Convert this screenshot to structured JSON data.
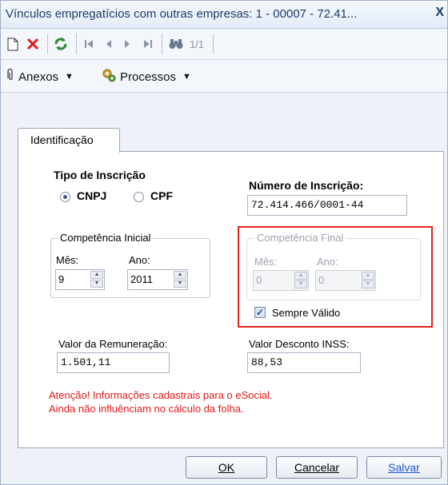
{
  "window": {
    "title": "Vínculos empregatícios com outras empresas: 1 - 00007 - 72.41...",
    "close_label": "X"
  },
  "toolbar": {
    "record_counter": "1/1",
    "icons": [
      "new-document-icon",
      "delete-icon",
      "refresh-icon",
      "first-record-icon",
      "previous-record-icon",
      "next-record-icon",
      "last-record-icon",
      "binoculars-icon"
    ]
  },
  "menus": {
    "anexos_label": "Anexos",
    "processos_label": "Processos"
  },
  "tabs": [
    {
      "label": "Identificação"
    }
  ],
  "form": {
    "tipo_inscricao": {
      "title": "Tipo de Inscrição",
      "cnpj_label": "CNPJ",
      "cpf_label": "CPF",
      "selected": "CNPJ"
    },
    "numero_inscricao": {
      "label": "Número de Inscrição:",
      "value": "72.414.466/0001-44"
    },
    "competencia_inicial": {
      "title": "Competência Inicial",
      "mes_label": "Mês:",
      "mes_value": "9",
      "ano_label": "Ano:",
      "ano_value": "2011"
    },
    "competencia_final": {
      "title": "Competência Final",
      "mes_label": "Mês:",
      "mes_value": "0",
      "ano_label": "Ano:",
      "ano_value": "0"
    },
    "sempre_valido": {
      "label": "Sempre Válido",
      "checked": true
    },
    "valor_remuneracao": {
      "label": "Valor da Remuneração:",
      "value": "1.501,11"
    },
    "valor_desconto_inss": {
      "label": "Valor Desconto INSS:",
      "value": "88,53"
    }
  },
  "warning": {
    "line1": "Atenção! Informações cadastrais para o eSocial.",
    "line2": "Ainda não influênciam no cálculo da folha."
  },
  "buttons": {
    "ok_label": "OK",
    "cancel_label": "Cancelar",
    "save_label": "Salvar"
  },
  "colors": {
    "warning": "#e01a1a",
    "highlight_box": "#e0231f",
    "title_text": "#1f3b6d"
  }
}
